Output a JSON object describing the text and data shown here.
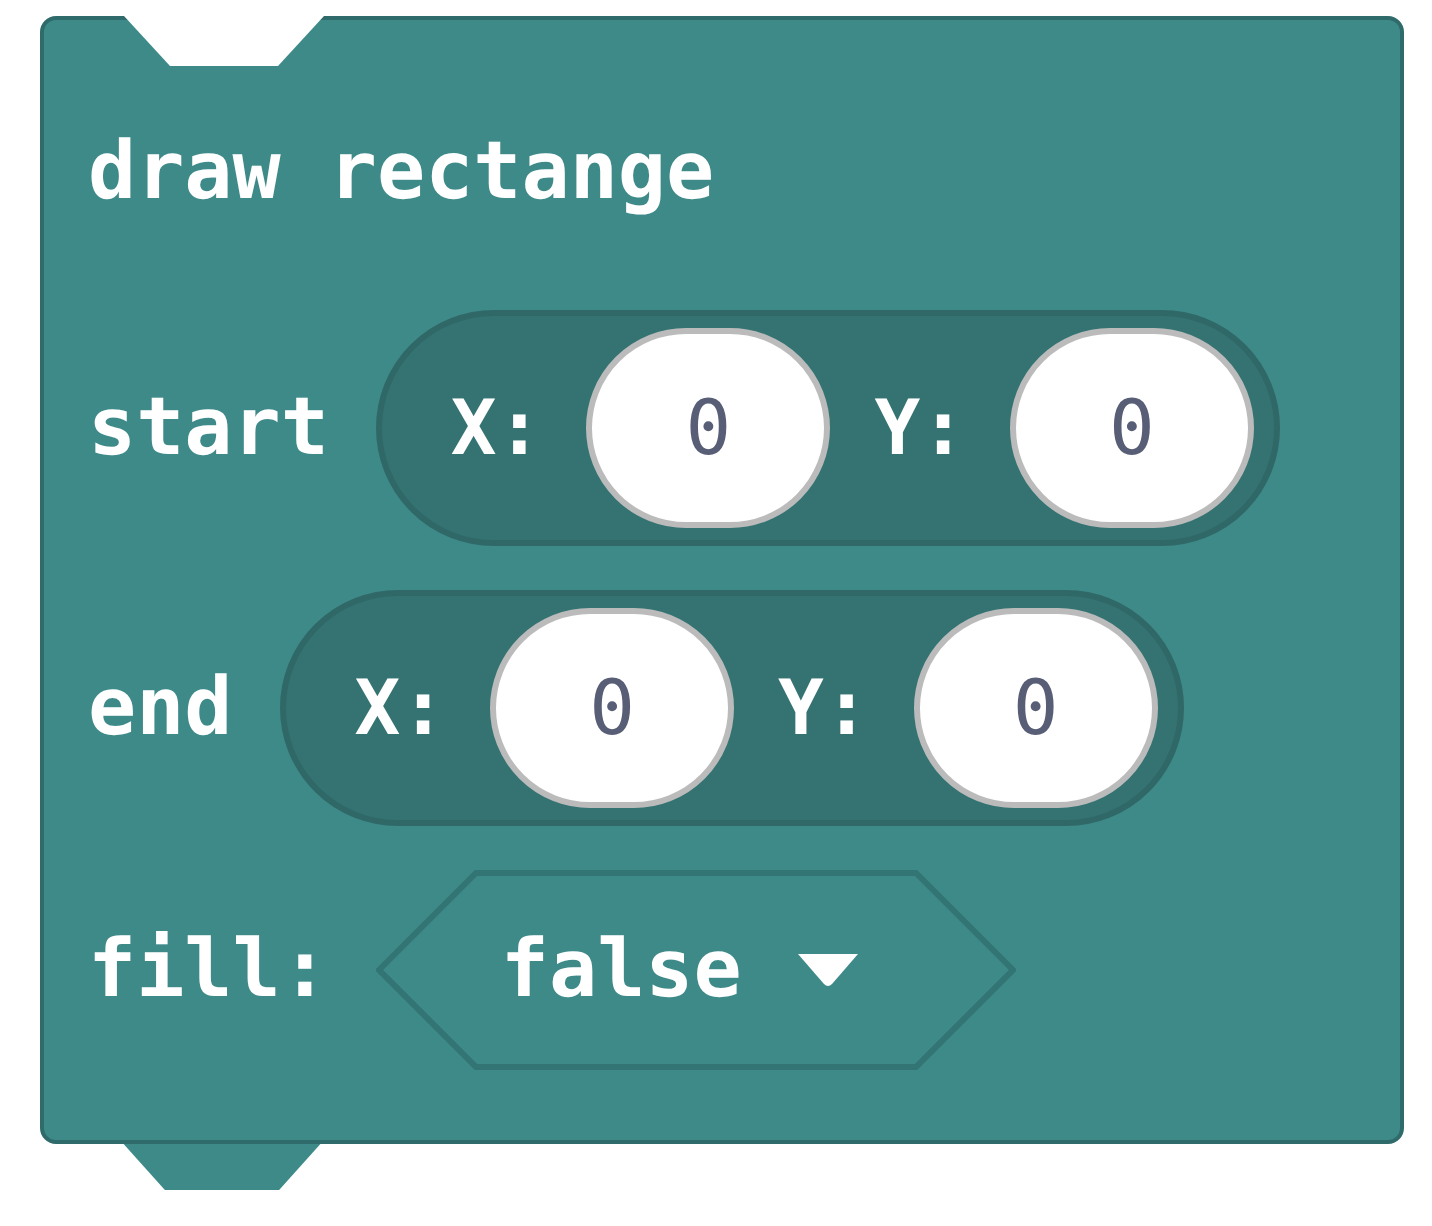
{
  "block": {
    "title": "draw rectange",
    "rows": [
      {
        "kind": "point",
        "label": "start",
        "fields": [
          {
            "label": "X:",
            "value": "0"
          },
          {
            "label": "Y:",
            "value": "0"
          }
        ]
      },
      {
        "kind": "point",
        "label": "end",
        "fields": [
          {
            "label": "X:",
            "value": "0"
          },
          {
            "label": "Y:",
            "value": "0"
          }
        ]
      },
      {
        "kind": "dropdown",
        "label": "fill:",
        "value": "false"
      }
    ]
  }
}
